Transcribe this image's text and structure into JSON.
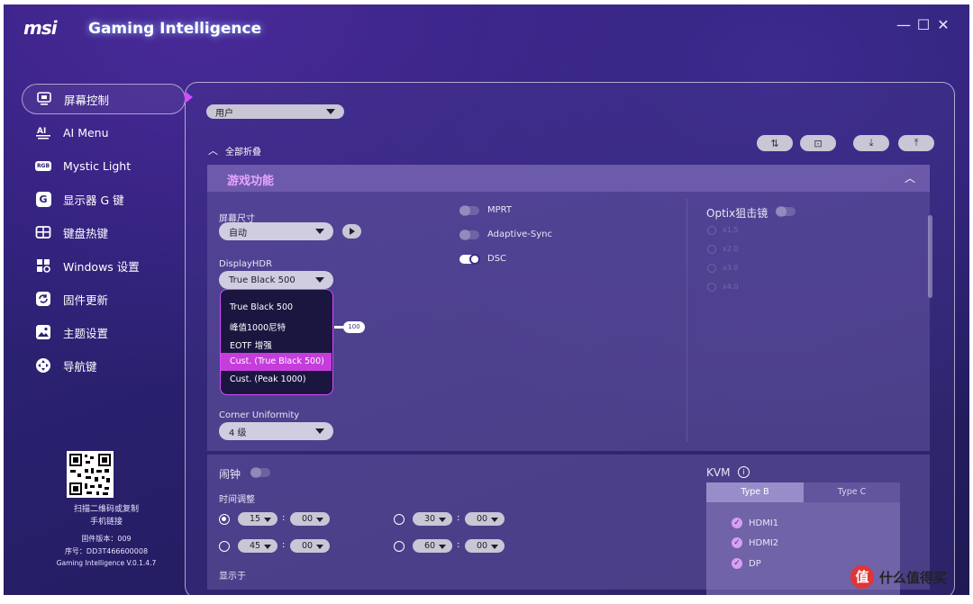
{
  "title_bar": {
    "logo": "msi",
    "app_title": "Gaming Intelligence",
    "controls": {
      "minimize": "—",
      "maximize": "☐",
      "close": "✕"
    }
  },
  "sidebar": {
    "items": [
      {
        "label": "屏幕控制",
        "icon": "monitor-icon",
        "active": true
      },
      {
        "label": "AI Menu",
        "icon": "ai-icon"
      },
      {
        "label": "Mystic Light",
        "icon": "rgb-icon",
        "icon_text": "RGB"
      },
      {
        "label": "显示器 G 键",
        "icon": "g-key-icon",
        "icon_text": "G"
      },
      {
        "label": "键盘热键",
        "icon": "keyboard-icon"
      },
      {
        "label": "Windows 设置",
        "icon": "windows-icon"
      },
      {
        "label": "固件更新",
        "icon": "firmware-update-icon"
      },
      {
        "label": "主题设置",
        "icon": "theme-icon"
      },
      {
        "label": "导航键",
        "icon": "navigation-key-icon"
      }
    ],
    "qr_caption_line1": "扫描二维码或复制",
    "qr_caption_line2": "手机链接",
    "firmware_version": "固件版本：009",
    "serial": "序号：DD3T466600008",
    "app_version": "Gaming Intelligence V.0.1.4.7"
  },
  "main": {
    "profile_select": "用户",
    "collapse_all": "全部折叠",
    "toolbar_icons": [
      "sort-icon",
      "screenshot-icon",
      "import-icon",
      "export-icon"
    ],
    "game_section": {
      "title": "游戏功能",
      "screen_size": {
        "label": "屏幕尺寸",
        "value": "自动"
      },
      "display_hdr": {
        "label": "DisplayHDR",
        "value": "True Black 500",
        "options": [
          "True Black 500",
          "峰值1000尼特",
          "EOTF 增强",
          "Cust. (True Black 500)",
          "Cust. (Peak 1000)"
        ],
        "highlighted": "Cust. (True Black 500)"
      },
      "slider_value": "100",
      "corner_uniformity": {
        "label": "Corner Uniformity",
        "value": "4 级"
      },
      "toggles": [
        {
          "label": "MPRT",
          "on": false
        },
        {
          "label": "Adaptive-Sync",
          "on": false
        },
        {
          "label": "DSC",
          "on": true
        }
      ],
      "optix_scope": {
        "label": "Optix狙击镜",
        "on": false,
        "options": [
          "x1.5",
          "x2.0",
          "x3.0",
          "x4.0"
        ]
      }
    },
    "alarm": {
      "title": "闹钟",
      "on": false,
      "time_adjust_label": "时间调整",
      "presets": [
        {
          "min": "15",
          "sec": "00",
          "selected": true
        },
        {
          "min": "30",
          "sec": "00",
          "selected": false
        },
        {
          "min": "45",
          "sec": "00",
          "selected": false
        },
        {
          "min": "60",
          "sec": "00",
          "selected": false
        }
      ],
      "show_at_label": "显示于"
    },
    "kvm": {
      "title": "KVM",
      "info_icon": "info-icon",
      "tabs": [
        "Type B",
        "Type C"
      ],
      "active_tab": "Type B",
      "inputs": [
        {
          "label": "HDMI1",
          "checked": true
        },
        {
          "label": "HDMI2",
          "checked": true
        },
        {
          "label": "DP",
          "checked": true
        }
      ]
    }
  },
  "watermark": {
    "glyph": "值",
    "text": "什么值得买"
  }
}
